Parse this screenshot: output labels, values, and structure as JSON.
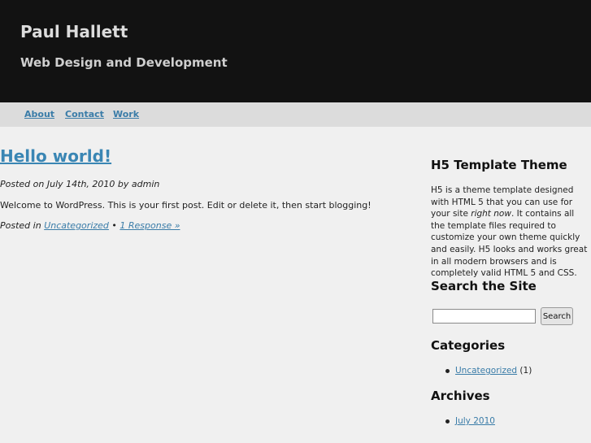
{
  "header": {
    "site_title": "Paul Hallett",
    "site_description": "Web Design and Development"
  },
  "nav": {
    "items": [
      {
        "label": "About"
      },
      {
        "label": "Contact"
      },
      {
        "label": "Work"
      }
    ]
  },
  "post": {
    "title": "Hello world!",
    "meta_prefix": "Posted on ",
    "date": "July 14th, 2010",
    "meta_by": " by ",
    "author": "admin",
    "body": "Welcome to WordPress. This is your first post. Edit or delete it, then start blogging!",
    "footer_prefix": "Posted in ",
    "category": "Uncategorized",
    "separator": " • ",
    "responses": "1 Response »"
  },
  "sidebar": {
    "theme_widget": {
      "title": "H5 Template Theme",
      "text_part1": "H5 is a theme template designed with HTML 5 that you can use for your site ",
      "text_emphasis": "right now",
      "text_part2": ". It contains all the template files required to customize your own theme quickly and easily. H5 looks and works great in all modern browsers and is completely valid HTML 5 and CSS."
    },
    "search_widget": {
      "title": "Search the Site",
      "input_value": "",
      "button_label": "Search"
    },
    "categories_widget": {
      "title": "Categories",
      "items": [
        {
          "label": "Uncategorized",
          "count": " (1)"
        }
      ]
    },
    "archives_widget": {
      "title": "Archives",
      "items": [
        {
          "label": "July 2010"
        }
      ]
    }
  }
}
